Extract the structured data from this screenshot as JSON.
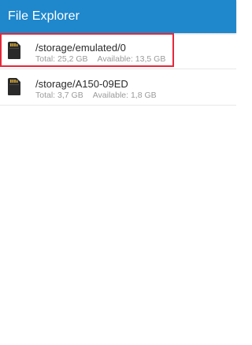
{
  "app": {
    "title": "File Explorer",
    "accent_color": "#1f87cc",
    "highlight_color": "#e5283a"
  },
  "storage_list": [
    {
      "path": "/storage/emulated/0",
      "total": "Total: 25,2 GB",
      "available": "Available: 13,5 GB",
      "icon": "sd-card-icon",
      "selected": true
    },
    {
      "path": "/storage/A150-09ED",
      "total": "Total: 3,7 GB",
      "available": "Available: 1,8 GB",
      "icon": "sd-card-icon",
      "selected": false
    }
  ]
}
